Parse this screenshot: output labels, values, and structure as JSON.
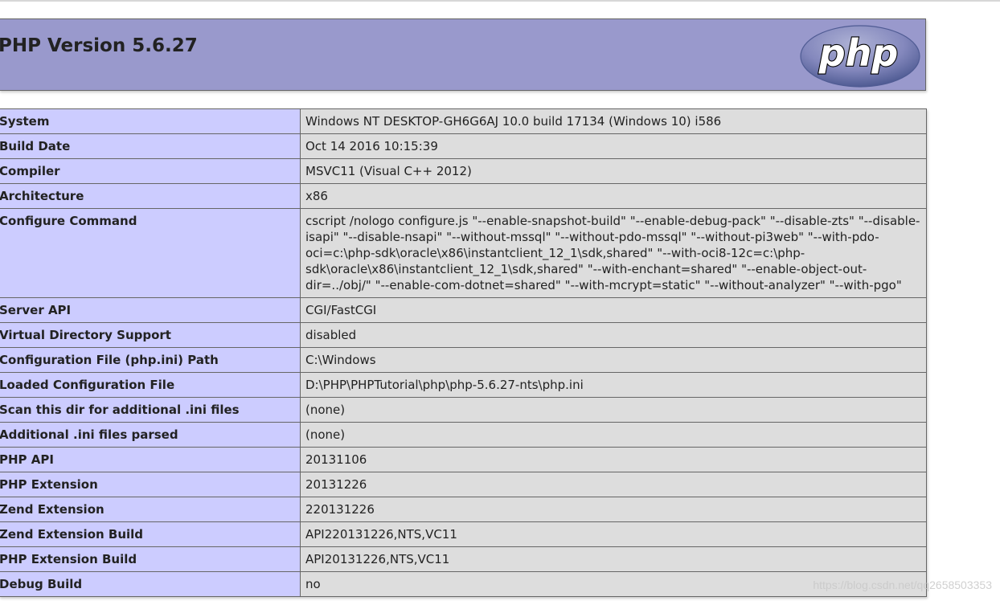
{
  "header": {
    "title": "PHP Version 5.6.27",
    "logo_text": "php"
  },
  "rows": [
    {
      "label": "System",
      "value": "Windows NT DESKTOP-GH6G6AJ 10.0 build 17134 (Windows 10) i586"
    },
    {
      "label": "Build Date",
      "value": "Oct 14 2016 10:15:39"
    },
    {
      "label": "Compiler",
      "value": "MSVC11 (Visual C++ 2012)"
    },
    {
      "label": "Architecture",
      "value": "x86"
    },
    {
      "label": "Configure Command",
      "value": "cscript /nologo configure.js \"--enable-snapshot-build\" \"--enable-debug-pack\" \"--disable-zts\" \"--disable-isapi\" \"--disable-nsapi\" \"--without-mssql\" \"--without-pdo-mssql\" \"--without-pi3web\" \"--with-pdo-oci=c:\\php-sdk\\oracle\\x86\\instantclient_12_1\\sdk,shared\" \"--with-oci8-12c=c:\\php-sdk\\oracle\\x86\\instantclient_12_1\\sdk,shared\" \"--with-enchant=shared\" \"--enable-object-out-dir=../obj/\" \"--enable-com-dotnet=shared\" \"--with-mcrypt=static\" \"--without-analyzer\" \"--with-pgo\""
    },
    {
      "label": "Server API",
      "value": "CGI/FastCGI"
    },
    {
      "label": "Virtual Directory Support",
      "value": "disabled"
    },
    {
      "label": "Configuration File (php.ini) Path",
      "value": "C:\\Windows"
    },
    {
      "label": "Loaded Configuration File",
      "value": "D:\\PHP\\PHPTutorial\\php\\php-5.6.27-nts\\php.ini"
    },
    {
      "label": "Scan this dir for additional .ini files",
      "value": "(none)"
    },
    {
      "label": "Additional .ini files parsed",
      "value": "(none)"
    },
    {
      "label": "PHP API",
      "value": "20131106"
    },
    {
      "label": "PHP Extension",
      "value": "20131226"
    },
    {
      "label": "Zend Extension",
      "value": "220131226"
    },
    {
      "label": "Zend Extension Build",
      "value": "API220131226,NTS,VC11"
    },
    {
      "label": "PHP Extension Build",
      "value": "API20131226,NTS,VC11"
    },
    {
      "label": "Debug Build",
      "value": "no"
    }
  ],
  "watermark": "https://blog.csdn.net/qq2658503353",
  "colors": {
    "header_bg": "#9999cc",
    "label_bg": "#ccccff",
    "value_bg": "#dddddd",
    "border": "#666666"
  }
}
